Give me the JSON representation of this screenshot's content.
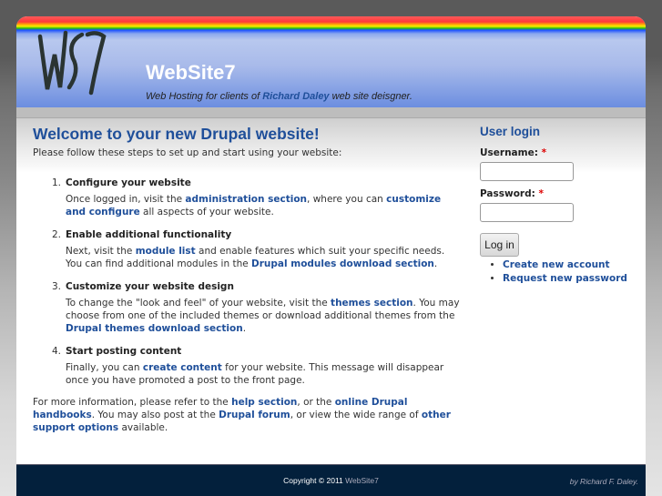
{
  "header": {
    "logo_text": "WS7",
    "site_name": "WebSite7",
    "slogan_pre": "Web Hosting for clients of ",
    "slogan_link": "Richard Daley",
    "slogan_post": " web site deisgner."
  },
  "main": {
    "title": "Welcome to your new Drupal website!",
    "intro": "Please follow these steps to set up and start using your website:",
    "steps": [
      {
        "num": "1.",
        "title": "Configure your website",
        "s": [
          "Once logged in, visit the ",
          "administration section",
          ", where you can ",
          "customize and configure",
          " all aspects of your website."
        ]
      },
      {
        "num": "2.",
        "title": "Enable additional functionality",
        "s": [
          "Next, visit the ",
          "module list",
          " and enable features which suit your specific needs. You can find additional modules in the ",
          "Drupal modules download section",
          "."
        ]
      },
      {
        "num": "3.",
        "title": "Customize your website design",
        "s": [
          "To change the \"look and feel\" of your website, visit the ",
          "themes section",
          ". You may choose from one of the included themes or download additional themes from the ",
          "Drupal themes download section",
          "."
        ]
      },
      {
        "num": "4.",
        "title": "Start posting content",
        "s": [
          "Finally, you can ",
          "create content",
          " for your website. This message will disappear once you have promoted a post to the front page."
        ]
      }
    ],
    "more": [
      "For more information, please refer to the ",
      "help section",
      ", or the ",
      "online Drupal handbooks",
      ". You may also post at the ",
      "Drupal forum",
      ", or view the wide range of ",
      "other support options",
      " available."
    ]
  },
  "login": {
    "title": "User login",
    "username_label": "Username:",
    "password_label": "Password:",
    "required": "*",
    "username_value": "",
    "password_value": "",
    "submit": "Log in",
    "links": [
      "Create new account",
      "Request new password"
    ]
  },
  "footer": {
    "copyright": "Copyright © 2011 ",
    "site": "WebSite7",
    "by": "by Richard F. Daley."
  },
  "colors": {
    "link": "#1f4f9a",
    "footer_bg": "#03203c"
  }
}
